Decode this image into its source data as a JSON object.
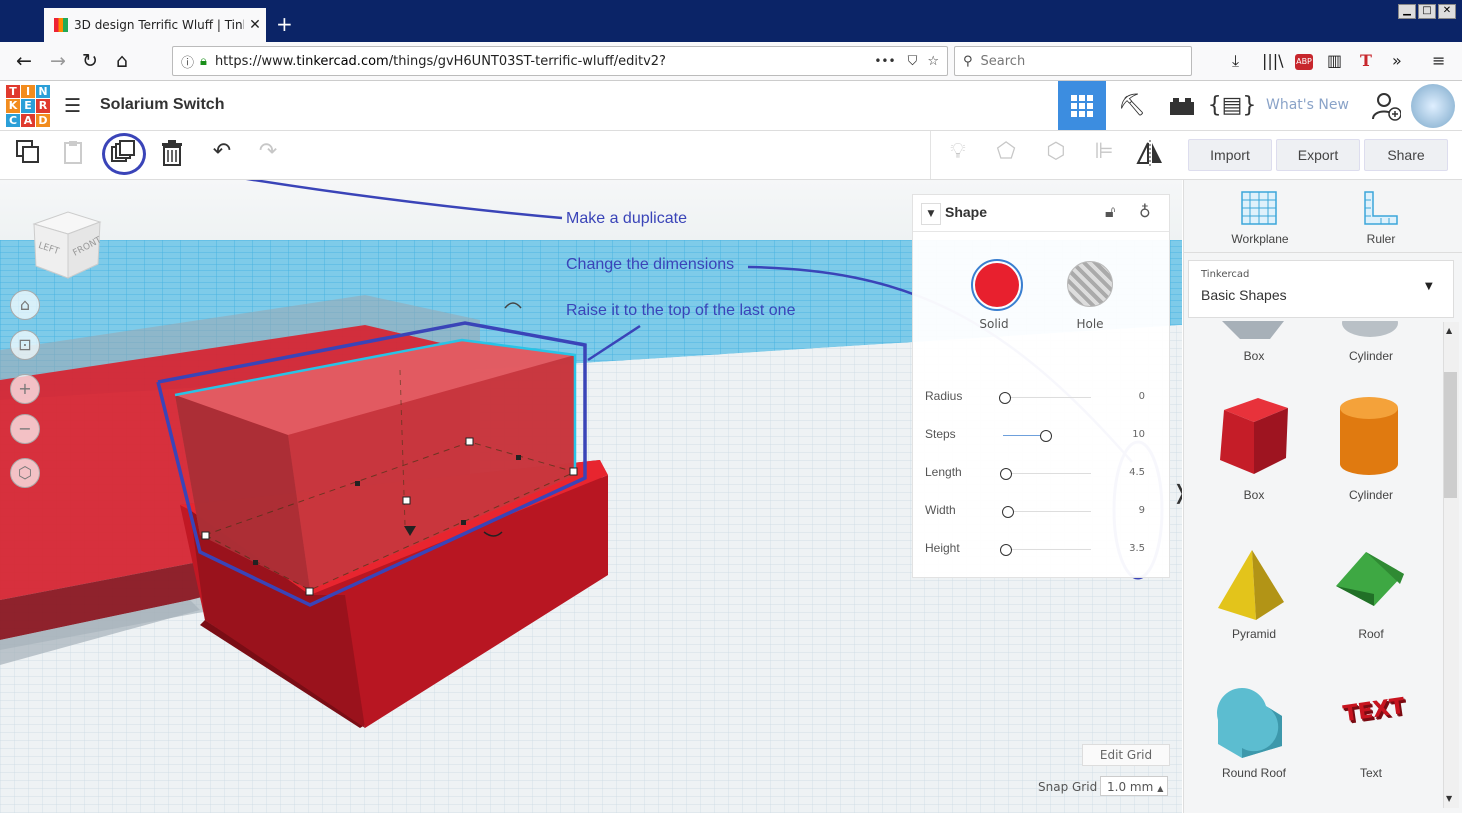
{
  "browser": {
    "tab_title": "3D design Terrific Wluff | Tinkercad",
    "tab_close": "✕",
    "new_tab": "+",
    "url_prefix": "https://www.",
    "url_domain": "tinkercad.com",
    "url_path": "/things/gvH6UNT03ST-terrific-wluff/editv2?",
    "url_more": "•••",
    "search_placeholder": "Search",
    "win_controls": [
      "▁",
      "□",
      "✕"
    ]
  },
  "header": {
    "logo_letters": [
      "TIN",
      "KER",
      "CAD"
    ],
    "logo_grid": [
      "T",
      "I",
      "N",
      "K",
      "E",
      "R",
      "C",
      "A",
      "D"
    ],
    "logo_colors": [
      "#e03a2e",
      "#f28c1e",
      "#2b9fd8",
      "#f28c1e",
      "#2b9fd8",
      "#e03a2e",
      "#2b9fd8",
      "#e03a2e",
      "#f28c1e"
    ],
    "design_title": "Solarium Switch",
    "whats_new": "What's New"
  },
  "toolbar": {
    "import_label": "Import",
    "export_label": "Export",
    "share_label": "Share"
  },
  "viewcube": {
    "left": "LEFT",
    "front": "FRONT"
  },
  "annotations": {
    "duplicate": "Make a duplicate",
    "dimensions": "Change the dimensions",
    "raise": "Raise it to the top of the last one"
  },
  "shape_panel": {
    "title": "Shape",
    "solid_label": "Solid",
    "hole_label": "Hole",
    "solid_color": "#e8202e",
    "props": [
      {
        "label": "Radius",
        "value": "0"
      },
      {
        "label": "Steps",
        "value": "10"
      },
      {
        "label": "Length",
        "value": "4.5"
      },
      {
        "label": "Width",
        "value": "9"
      },
      {
        "label": "Height",
        "value": "3.5"
      }
    ]
  },
  "grid": {
    "edit_grid": "Edit Grid",
    "snap_label": "Snap Grid",
    "snap_value": "1.0 mm"
  },
  "right_panel": {
    "workplane": "Workplane",
    "ruler": "Ruler",
    "library_source": "Tinkercad",
    "library_name": "Basic Shapes",
    "shapes": [
      {
        "label": "Box"
      },
      {
        "label": "Cylinder"
      },
      {
        "label": "Box"
      },
      {
        "label": "Cylinder"
      },
      {
        "label": "Pyramid"
      },
      {
        "label": "Roof"
      },
      {
        "label": "Round Roof"
      },
      {
        "label": "Text"
      }
    ],
    "text_shape_glyph": "TEXT"
  },
  "colors": {
    "accent_blue": "#3a44b8",
    "selection_cyan": "#29c3e6",
    "shape_red": "#d91f2c"
  }
}
